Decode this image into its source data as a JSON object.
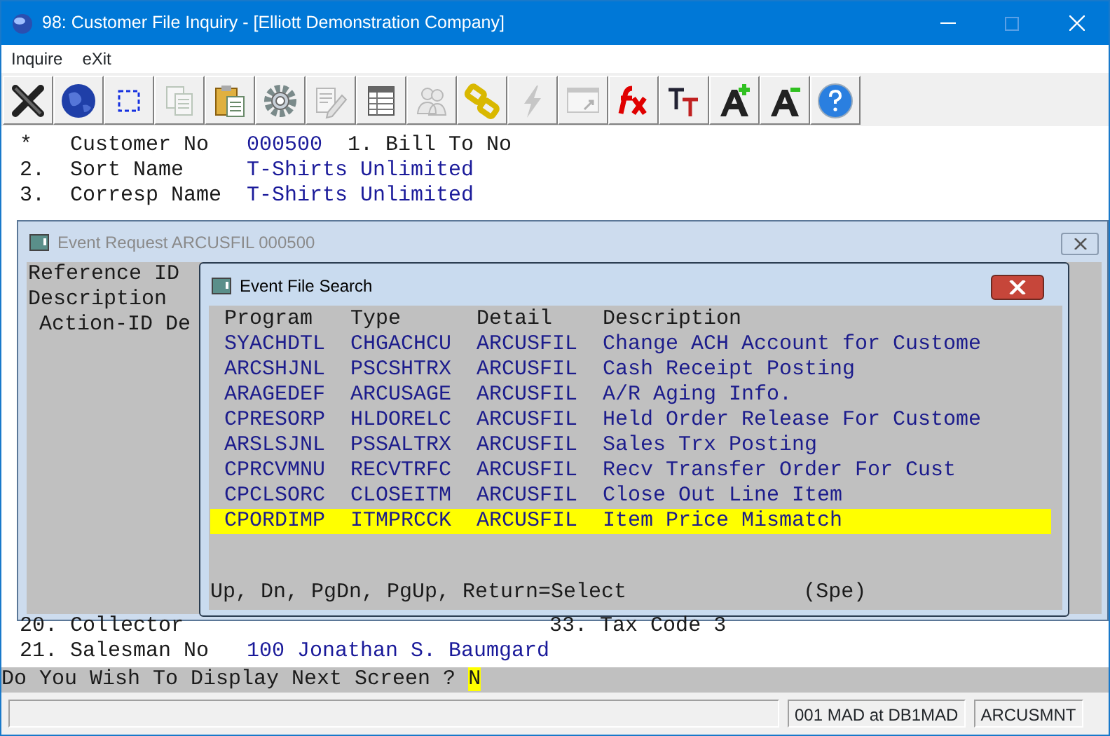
{
  "window": {
    "title": "98: Customer File Inquiry - [Elliott Demonstration Company]"
  },
  "menu": [
    {
      "label": "Inquire"
    },
    {
      "label": "eXit"
    }
  ],
  "toolbar": [
    {
      "disabled": false
    },
    {
      "disabled": false
    },
    {
      "disabled": false
    },
    {
      "disabled": true
    },
    {
      "disabled": false
    },
    {
      "disabled": false
    },
    {
      "disabled": true
    },
    {
      "disabled": false
    },
    {
      "disabled": true
    },
    {
      "disabled": false
    },
    {
      "disabled": true
    },
    {
      "disabled": true
    },
    {
      "disabled": false
    },
    {
      "disabled": false
    },
    {
      "disabled": false
    },
    {
      "disabled": false
    },
    {
      "disabled": false
    }
  ],
  "fields_top": [
    {
      "number": "*",
      "label": "Customer No",
      "value": "000500",
      "extra": "1. Bill To No"
    },
    {
      "number": "2.",
      "label": "Sort Name",
      "value": "T-Shirts Unlimited"
    },
    {
      "number": "3.",
      "label": "Corresp Name",
      "value": "T-Shirts Unlimited"
    }
  ],
  "fields_bottom": [
    {
      "number": "20.",
      "label": "Collector",
      "extra": "33. Tax Code 3"
    },
    {
      "number": "21.",
      "label": "Salesman No",
      "value": "100 Jonathan S. Baumgard"
    }
  ],
  "event_request": {
    "title": "Event Request ARCUSFIL 000500",
    "lines": [
      "Reference ID",
      "Description",
      "Action-ID De"
    ]
  },
  "event_search": {
    "title": "Event File Search",
    "columns": [
      "Program",
      "Type",
      "Detail",
      "Description"
    ],
    "rows": [
      {
        "cells": [
          "SYACHDTL",
          "CHGACHCU",
          "ARCUSFIL",
          "Change ACH Account for Custome"
        ],
        "selected": false
      },
      {
        "cells": [
          "ARCSHJNL",
          "PSCSHTRX",
          "ARCUSFIL",
          "Cash Receipt Posting"
        ],
        "selected": false
      },
      {
        "cells": [
          "ARAGEDEF",
          "ARCUSAGE",
          "ARCUSFIL",
          "A/R Aging Info."
        ],
        "selected": false
      },
      {
        "cells": [
          "CPRESORP",
          "HLDORELC",
          "ARCUSFIL",
          "Held Order Release For Custome"
        ],
        "selected": false
      },
      {
        "cells": [
          "ARSLSJNL",
          "PSSALTRX",
          "ARCUSFIL",
          "Sales Trx Posting"
        ],
        "selected": false
      },
      {
        "cells": [
          "CPRCVMNU",
          "RECVTRFC",
          "ARCUSFIL",
          "Recv Transfer Order For Cust"
        ],
        "selected": false
      },
      {
        "cells": [
          "CPCLSORC",
          "CLOSEITM",
          "ARCUSFIL",
          "Close Out Line Item"
        ],
        "selected": false
      },
      {
        "cells": [
          "CPORDIMP",
          "ITMPRCCK",
          "ARCUSFIL",
          "Item Price Mismatch"
        ],
        "selected": true
      }
    ],
    "footer": "Up, Dn, PgDn, PgUp, Return=Select",
    "footer_hint": "(Spe)"
  },
  "prompt": {
    "text": "Do You Wish To Display Next Screen ?",
    "answer": "N"
  },
  "status_bar": [
    "001 MAD at DB1MAD",
    "ARCUSMNT"
  ]
}
